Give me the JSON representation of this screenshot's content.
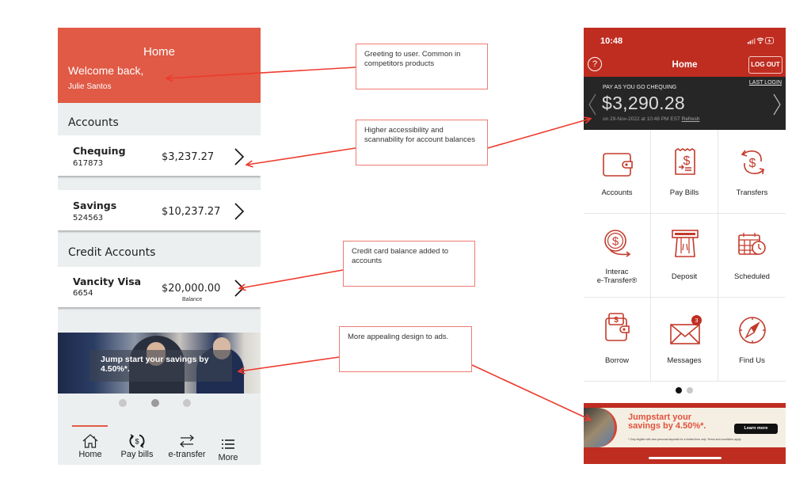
{
  "left_phone": {
    "header": {
      "title": "Home",
      "welcome": "Welcome back,",
      "user_name": "Julie Santos"
    },
    "sections": {
      "accounts": "Accounts",
      "credit_accounts": "Credit Accounts"
    },
    "accounts": [
      {
        "name": "Chequing",
        "number": "617873",
        "balance": "$3,237.27"
      },
      {
        "name": "Savings",
        "number": "524563",
        "balance": "$10,237.27"
      }
    ],
    "credit_accounts": [
      {
        "name": "Vancity Visa",
        "number": "6654",
        "balance": "$20,000.00",
        "balance_label": "Balance"
      }
    ],
    "banner": {
      "text": "Jump start your savings by 4.50%*."
    },
    "carousel": {
      "count": 3,
      "active_index": 1
    },
    "bottom_nav": [
      {
        "label": "Home",
        "icon": "home-icon",
        "active": true
      },
      {
        "label": "Pay bills",
        "icon": "pay-bills-icon",
        "active": false
      },
      {
        "label": "e-transfer",
        "icon": "transfer-arrows-icon",
        "active": false
      },
      {
        "label": "More",
        "icon": "menu-list-icon",
        "active": false
      }
    ],
    "colors": {
      "brand": "#e05a45",
      "background": "#eceff0"
    }
  },
  "annotations": [
    {
      "id": "greeting",
      "text": "Greeting to user. Common in competitors products"
    },
    {
      "id": "accessibility",
      "text": "Higher accessibility and scannability for account balances"
    },
    {
      "id": "credit",
      "text": "Credit card balance added to accounts"
    },
    {
      "id": "ads",
      "text": "More appealing design to ads."
    }
  ],
  "right_phone": {
    "status_bar": {
      "time": "10:48",
      "icons": [
        "signal-icon",
        "wifi-icon",
        "battery-charging-icon"
      ]
    },
    "header": {
      "help_label": "?",
      "title": "Home",
      "logout_label": "LOG OUT"
    },
    "balance_panel": {
      "account_type": "PAY AS YOU GO CHEQUING",
      "last_login_label": "LAST LOGIN",
      "amount": "$3,290.28",
      "as_of": "on 29-Nov-2022 at 10:48 PM EST",
      "refresh_label": "Refresh"
    },
    "tiles": [
      {
        "label": "Accounts",
        "icon": "wallet-icon"
      },
      {
        "label": "Pay Bills",
        "icon": "bill-receipt-icon"
      },
      {
        "label": "Transfers",
        "icon": "transfer-dollar-icon"
      },
      {
        "label": "Interac",
        "label2": "e-Transfer®",
        "icon": "interac-etransfer-icon"
      },
      {
        "label": "Deposit",
        "icon": "atm-deposit-icon"
      },
      {
        "label": "Scheduled",
        "icon": "calendar-clock-icon"
      },
      {
        "label": "Borrow",
        "icon": "borrow-wallet-icon"
      },
      {
        "label": "Messages",
        "icon": "envelope-icon",
        "badge": "3"
      },
      {
        "label": "Find Us",
        "icon": "compass-icon"
      }
    ],
    "pager": {
      "count": 2,
      "active_index": 0
    },
    "ad": {
      "title_line1": "Jumpstart your",
      "title_line2": "savings by 4.50%*.",
      "button_label": "Learn more",
      "fine_print": "* Only eligible with new personal deposits for a limited time only. Terms and conditions apply."
    },
    "colors": {
      "brand": "#bf2d21",
      "panel": "#262626"
    }
  },
  "annotation_colors": {
    "arrow": "#ee3b2e",
    "box_border": "#f07b73"
  }
}
